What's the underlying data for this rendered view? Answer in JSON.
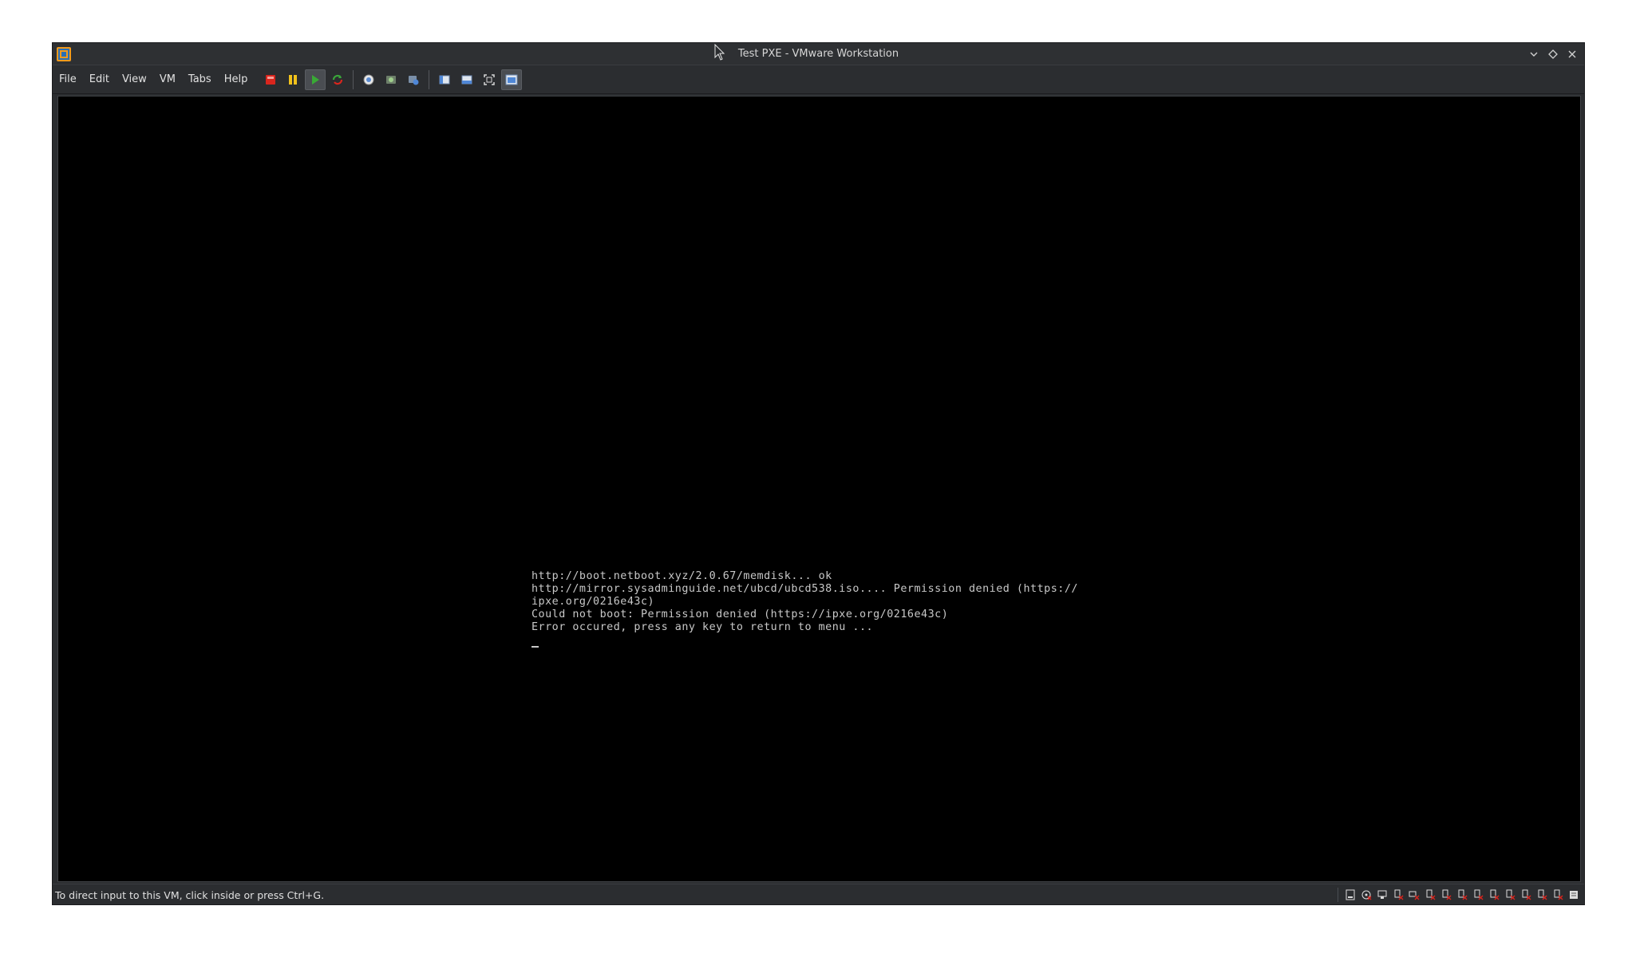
{
  "window": {
    "title": "Test PXE - VMware Workstation"
  },
  "menu": {
    "items": [
      "File",
      "Edit",
      "View",
      "VM",
      "Tabs",
      "Help"
    ]
  },
  "toolbar": {
    "icons": [
      "power-off-icon",
      "suspend-icon",
      "power-on-icon",
      "reset-icon",
      "snapshot-icon",
      "revert-snapshot-icon",
      "snapshot-manager-icon",
      "library-icon",
      "thumbnail-bar-icon",
      "full-screen-icon",
      "console-view-icon"
    ]
  },
  "console": {
    "lines": [
      "http://boot.netboot.xyz/2.0.67/memdisk... ok",
      "http://mirror.sysadminguide.net/ubcd/ubcd538.iso.... Permission denied (https://",
      "ipxe.org/0216e43c)",
      "Could not boot: Permission denied (https://ipxe.org/0216e43c)",
      "Error occured, press any key to return to menu ..."
    ]
  },
  "status": {
    "message": "To direct input to this VM, click inside or press Ctrl+G."
  },
  "colors": {
    "window_bg": "#2b2d30",
    "vm_bg": "#000000",
    "console_text": "#c8c8c8",
    "accent_orange": "#f29a1c"
  }
}
